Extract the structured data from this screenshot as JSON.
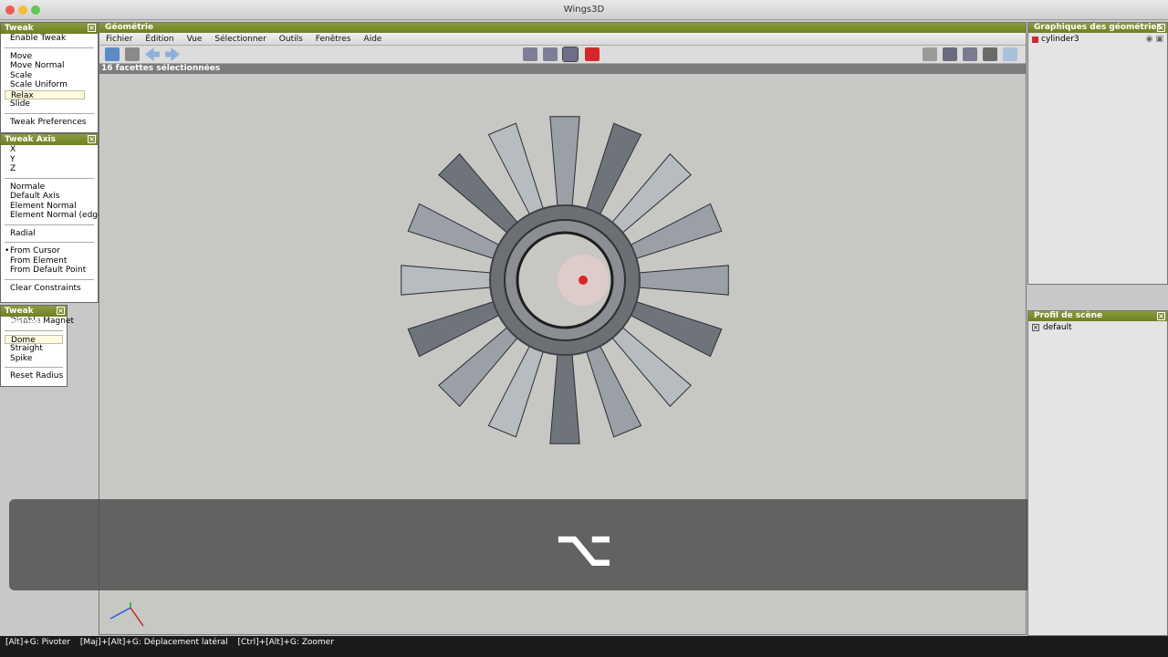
{
  "window": {
    "title": "Wings3D"
  },
  "tweak": {
    "title": "Tweak",
    "items": [
      "Enable Tweak",
      "Move",
      "Move Normal",
      "Scale",
      "Scale Uniform",
      "Relax",
      "Slide",
      "Tweak Preferences"
    ]
  },
  "tweak_axis": {
    "title": "Tweak Axis",
    "axes": [
      "X",
      "Y",
      "Z"
    ],
    "modes": [
      "Normale",
      "Default Axis",
      "Element Normal",
      "Element Normal (edges)"
    ],
    "radial": "Radial",
    "from": [
      "From Cursor",
      "From Element",
      "From Default Point"
    ],
    "clear": "Clear Constraints"
  },
  "tweak_magnet": {
    "title": "Tweak Magnet",
    "disable": "Disable Magnet",
    "types": [
      "Dome",
      "Straight",
      "Spike"
    ],
    "reset": "Reset Radius"
  },
  "geometry": {
    "title": "Géométrie",
    "menu": [
      "Fichier",
      "Édition",
      "Vue",
      "Sélectionner",
      "Outils",
      "Fenêtres",
      "Aide"
    ],
    "info": "16 facettes sélectionnées"
  },
  "overlay": {
    "key_symbol": "⌥"
  },
  "outliner": {
    "title": "Graphiques des géométries",
    "object": "cylinder3"
  },
  "scene_profile": {
    "title": "Profil de scène",
    "item": "default"
  },
  "status": [
    "[Alt]+G: Pivoter",
    "[Maj]+[Alt]+G: Déplacement latéral",
    "[Ctrl]+[Alt]+G: Zoomer"
  ],
  "colors": {
    "panel_header": "#7a8c2c",
    "selection_red": "#d62828",
    "viewport_bg": "#c7c7c4"
  }
}
